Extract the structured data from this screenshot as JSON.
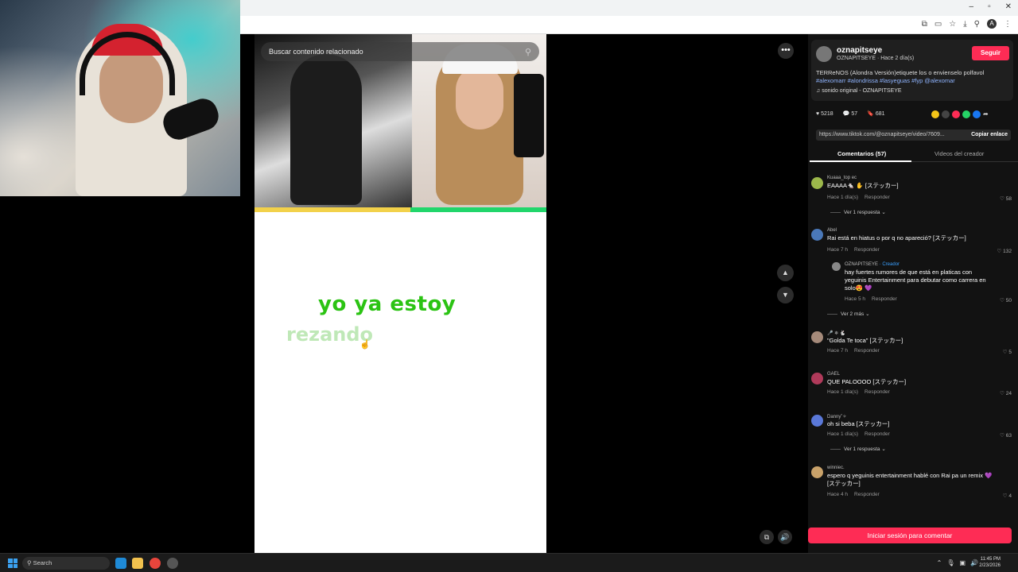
{
  "browser": {
    "window_controls": [
      "–",
      "▫",
      "✕"
    ],
    "toolbar_icons": [
      "translate-icon",
      "cast-icon",
      "star-icon",
      "download-icon",
      "extension-icon",
      "menu-icon"
    ],
    "profile_initial": "A"
  },
  "video": {
    "search_placeholder": "Buscar contenido relacionado",
    "lyric_line1": "yo ya estoy",
    "lyric_line2": "rezando"
  },
  "post": {
    "username": "oznapitseye",
    "subtitle": "OZNAPITSEYE · Hace 2 día(s)",
    "follow_label": "Seguir",
    "description": "TERReNOS (Alondra Versión)etiquete los o envienselo polfavol",
    "hashtags": "#alexomarr #alondrissa #lasyeguas #fyp @alexomar",
    "sound": "sonido original - OZNAPITSEYE",
    "likes": "5218",
    "comments": "57",
    "saves": "681",
    "link": "https://www.tiktok.com/@oznapitseye/video/7609...",
    "copy_label": "Copiar enlace",
    "share_colors": [
      "#f5c518",
      "#444444",
      "#fe2c55",
      "#25d366",
      "#1877f2"
    ]
  },
  "tabs": {
    "comments": "Comentarios (57)",
    "creator_videos": "Videos del creador"
  },
  "comments": [
    {
      "name": "Kuaaa_top ec",
      "text": "EAAAA🐁 ✋ [ステッカー]",
      "time": "Hace 1 día(s)",
      "reply": "Responder",
      "likes": "58",
      "more": "Ver 1 respuesta"
    },
    {
      "name": "Abel",
      "text": "Rai está en hiatus o por q no apareció? [ステッカー]",
      "time": "Hace 7 h",
      "reply": "Responder",
      "likes": "132"
    },
    {
      "name": "OZNAPITSEYE",
      "badge": "· Creador",
      "text": "hay fuertes rumores de que está en platicas con yeguinis Entertainment para debutar como carrera en solo😍 💜",
      "time": "Hace 5 h",
      "reply": "Responder",
      "likes": "50",
      "more": "Ver 2 más"
    },
    {
      "name": "🎤 ❄ 🐇",
      "text": "\"Golda Te toca\" [ステッカー]",
      "time": "Hace 7 h",
      "reply": "Responder",
      "likes": "5"
    },
    {
      "name": "GAEL",
      "text": "QUE PALOOOO [ステッカー]",
      "time": "Hace 1 día(s)",
      "reply": "Responder",
      "likes": "24"
    },
    {
      "name": "Danny˚✧",
      "text": "oh si beba [ステッカー]",
      "time": "Hace 1 día(s)",
      "reply": "Responder",
      "likes": "63",
      "more": "Ver 1 respuesta"
    },
    {
      "name": "winniec.",
      "text": "espero q yeguinis entertainment hablé con Rai pa un remix 💜 [ステッカー]",
      "time": "Hace 4 h",
      "reply": "Responder",
      "likes": "4"
    }
  ],
  "login_label": "Iniciar sesión para comentar",
  "taskbar": {
    "search": "Search",
    "time": "11:45 PM",
    "date": "2/23/2026"
  }
}
